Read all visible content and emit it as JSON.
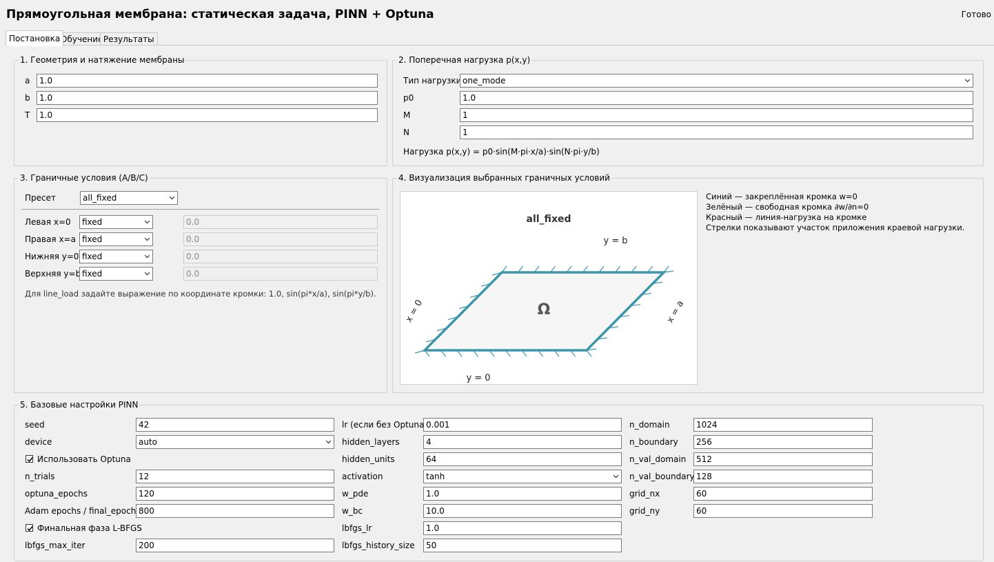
{
  "window": {
    "title": "Прямоугольная мембрана: статическая задача, PINN + Optuna",
    "status": "Готово"
  },
  "tabs": [
    {
      "label": "Постановка",
      "active": true
    },
    {
      "label": "Обучение",
      "active": false
    },
    {
      "label": "Результаты",
      "active": false
    }
  ],
  "geometry": {
    "title": "1. Геометрия и натяжение мембраны",
    "fields": [
      {
        "label": "a",
        "value": "1.0"
      },
      {
        "label": "b",
        "value": "1.0"
      },
      {
        "label": "T",
        "value": "1.0"
      }
    ]
  },
  "load": {
    "title": "2. Поперечная нагрузка p(x,y)",
    "type_label": "Тип нагрузки",
    "type_value": "one_mode",
    "fields": [
      {
        "label": "p0",
        "value": "1.0"
      },
      {
        "label": "M",
        "value": "1"
      },
      {
        "label": "N",
        "value": "1"
      }
    ],
    "formula": "Нагрузка p(x,y) = p0·sin(M·pi·x/a)·sin(N·pi·y/b)"
  },
  "boundary": {
    "title": "3. Граничные условия (A/B/C)",
    "preset_label": "Пресет",
    "preset_value": "all_fixed",
    "rows": [
      {
        "label": "Левая x=0",
        "type": "fixed",
        "value": "0.0"
      },
      {
        "label": "Правая x=a",
        "type": "fixed",
        "value": "0.0"
      },
      {
        "label": "Нижняя y=0",
        "type": "fixed",
        "value": "0.0"
      },
      {
        "label": "Верхняя y=b",
        "type": "fixed",
        "value": "0.0"
      }
    ],
    "hint": "Для line_load задайте выражение по координате кромки: 1.0, sin(pi*x/a), sin(pi*y/b)."
  },
  "visual": {
    "title": "4. Визуализация выбранных граничных условий",
    "preset": "all_fixed",
    "label_top": "y = b",
    "label_bottom": "y = 0",
    "label_left": "x = 0",
    "label_right": "x = a",
    "domain_symbol": "Ω",
    "legend": [
      "Синий — закреплённая кромка w=0",
      "Зелёный — свободная кромка ∂w/∂n=0",
      "Красный — линия-нагрузка на кромке",
      "Стрелки показывают участок приложения краевой нагрузки."
    ],
    "edge_color": "#3a96a8",
    "fill_color": "#f6f6f6"
  },
  "pinn": {
    "title": "5. Базовые настройки PINN",
    "col1": [
      {
        "label": "seed",
        "value": "42",
        "kind": "text"
      },
      {
        "label": "device",
        "value": "auto",
        "kind": "combo"
      },
      {
        "label": "Использовать Optuna",
        "checked": true,
        "kind": "check"
      },
      {
        "label": "n_trials",
        "value": "12",
        "kind": "text"
      },
      {
        "label": "optuna_epochs",
        "value": "120",
        "kind": "text"
      },
      {
        "label": "Adam epochs / final_epochs",
        "value": "800",
        "kind": "text"
      },
      {
        "label": "Финальная фаза L-BFGS",
        "checked": true,
        "kind": "check"
      },
      {
        "label": "lbfgs_max_iter",
        "value": "200",
        "kind": "text"
      }
    ],
    "col2": [
      {
        "label": "lr (если без Optuna)",
        "value": "0.001",
        "kind": "text"
      },
      {
        "label": "hidden_layers",
        "value": "4",
        "kind": "text"
      },
      {
        "label": "hidden_units",
        "value": "64",
        "kind": "text"
      },
      {
        "label": "activation",
        "value": "tanh",
        "kind": "combo"
      },
      {
        "label": "w_pde",
        "value": "1.0",
        "kind": "text"
      },
      {
        "label": "w_bc",
        "value": "10.0",
        "kind": "text"
      },
      {
        "label": "lbfgs_lr",
        "value": "1.0",
        "kind": "text"
      },
      {
        "label": "lbfgs_history_size",
        "value": "50",
        "kind": "text"
      }
    ],
    "col3": [
      {
        "label": "n_domain",
        "value": "1024",
        "kind": "text"
      },
      {
        "label": "n_boundary",
        "value": "256",
        "kind": "text"
      },
      {
        "label": "n_val_domain",
        "value": "512",
        "kind": "text"
      },
      {
        "label": "n_val_boundary",
        "value": "128",
        "kind": "text"
      },
      {
        "label": "grid_nx",
        "value": "60",
        "kind": "text"
      },
      {
        "label": "grid_ny",
        "value": "60",
        "kind": "text"
      }
    ]
  }
}
